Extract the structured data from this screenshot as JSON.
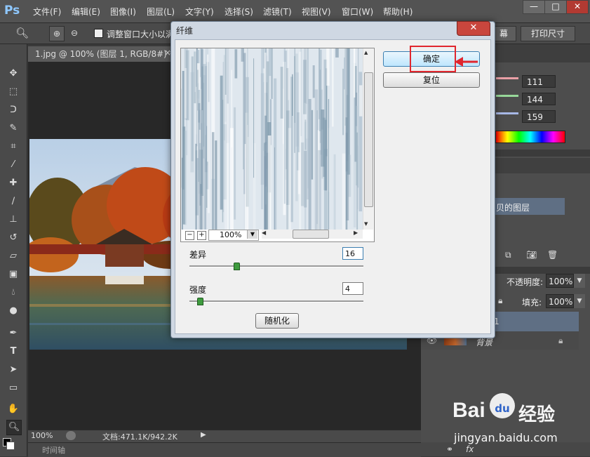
{
  "app": {
    "logo": "Ps"
  },
  "menu": [
    "文件(F)",
    "编辑(E)",
    "图像(I)",
    "图层(L)",
    "文字(Y)",
    "选择(S)",
    "滤镜(T)",
    "视图(V)",
    "窗口(W)",
    "帮助(H)"
  ],
  "window_controls": {
    "minimize": "—",
    "maximize": "□",
    "close": "✕"
  },
  "options_bar": {
    "checkbox_label": "调整窗口大小以满",
    "btn_screen": "幕",
    "btn_print_size": "打印尺寸"
  },
  "document": {
    "tab_title": "1.jpg @ 100% (图层 1, RGB/8#) *",
    "tab_close": "×",
    "zoom": "100%",
    "doc_info": "文档:471.1K/942.2K",
    "timeline_label": "时间轴"
  },
  "color_panel": {
    "r": "111",
    "g": "144",
    "b": "159"
  },
  "layers_panel": {
    "copy_layer_label": "贝的图层",
    "opacity_label": "不透明度:",
    "opacity_value": "100%",
    "fill_label": "填充:",
    "fill_value": "100%",
    "layer1_label": "1",
    "background_label": "背景"
  },
  "dialog": {
    "title": "纤维",
    "ok": "确定",
    "reset": "复位",
    "zoom_value": "100%",
    "zoom_minus": "−",
    "zoom_plus": "+",
    "variance_label": "差异",
    "variance_value": "16",
    "variance_level": 0.27,
    "strength_label": "强度",
    "strength_value": "4",
    "strength_level": 0.06,
    "randomize": "随机化"
  },
  "watermark": {
    "brand": "Bai",
    "paw": "du",
    "chinese": "经验",
    "url": "jingyan.baidu.com"
  },
  "colors": {
    "accent_red": "#e0262e",
    "ok_blue": "#bee6fd"
  }
}
